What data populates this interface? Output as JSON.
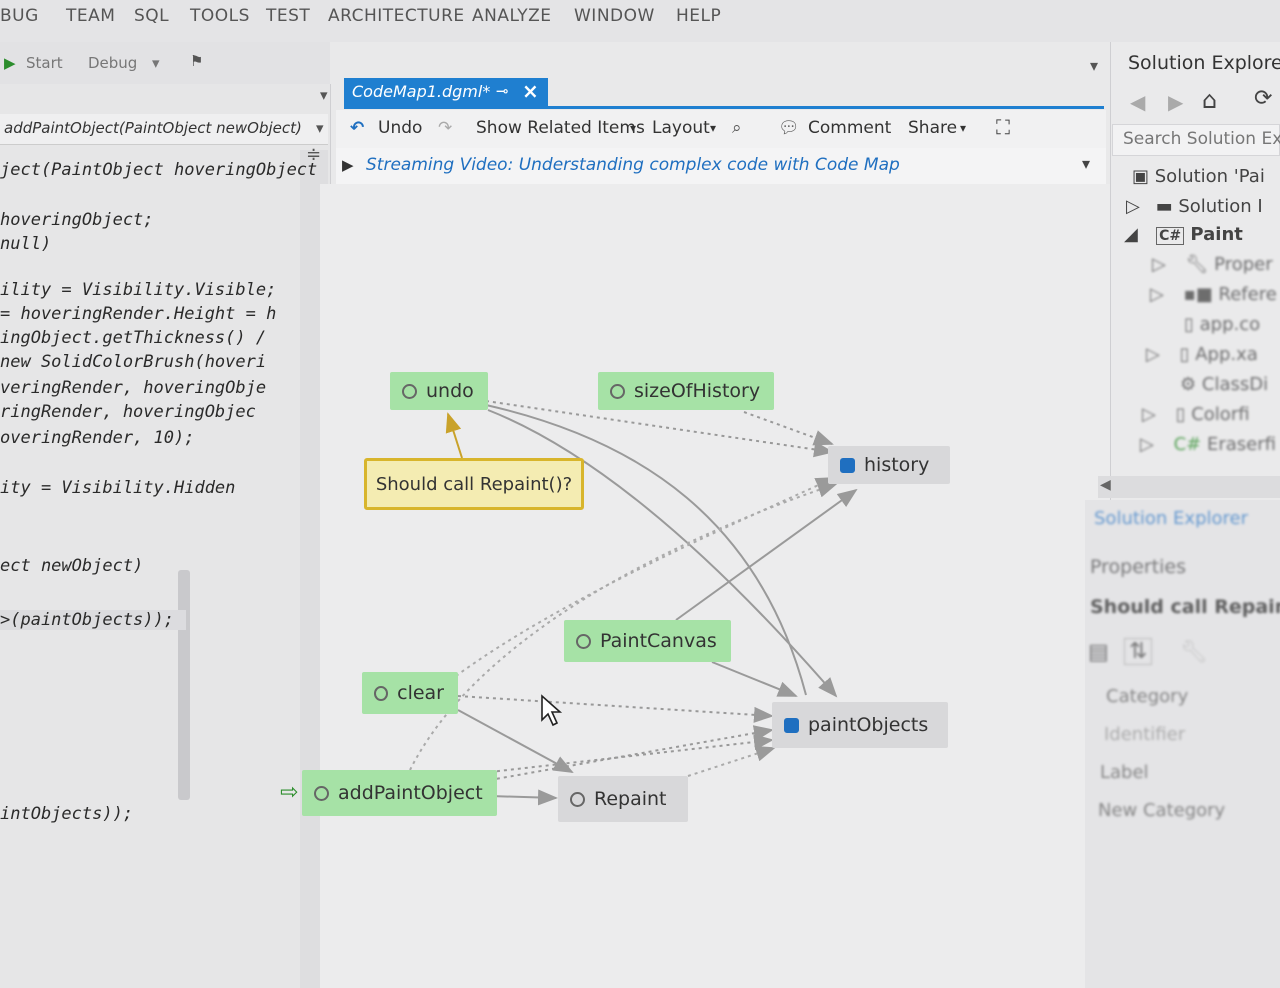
{
  "menu": [
    "BUG",
    "TEAM",
    "SQL",
    "TOOLS",
    "TEST",
    "ARCHITECTURE",
    "ANALYZE",
    "WINDOW",
    "HELP"
  ],
  "toolbar": {
    "start": "Start",
    "config": "Debug"
  },
  "editor": {
    "member_dropdown": "addPaintObject(PaintObject newObject)",
    "lines": [
      "ject(PaintObject hoveringObject",
      "hoveringObject;",
      "null)",
      "ility = Visibility.Visible;",
      "= hoveringRender.Height = h",
      "ingObject.getThickness() /",
      "new SolidColorBrush(hoveri",
      "veringRender, hoveringObje",
      "ringRender, hoveringObjec",
      "overingRender, 10);",
      "ity = Visibility.Hidden",
      "ect newObject)",
      ">(paintObjects));",
      "intObjects));"
    ]
  },
  "document": {
    "tab_title": "CodeMap1.dgml*",
    "toolbar": {
      "undo": "Undo",
      "show_related": "Show Related Items",
      "layout": "Layout",
      "comment": "Comment",
      "share": "Share"
    },
    "info_bar": "Streaming Video: Understanding complex code with Code Map"
  },
  "codemap": {
    "nodes": {
      "undo": "undo",
      "sizeOfHistory": "sizeOfHistory",
      "history": "history",
      "PaintCanvas": "PaintCanvas",
      "clear": "clear",
      "paintObjects": "paintObjects",
      "addPaintObject": "addPaintObject",
      "Repaint": "Repaint"
    },
    "comment": "Should call Repaint()?"
  },
  "solution_explorer": {
    "title": "Solution Explorer",
    "search_placeholder": "Search Solution Ex",
    "items": [
      "Solution 'Pai",
      "Solution I",
      "Paint",
      "Proper",
      "Refere",
      "app.co",
      "App.xa",
      "ClassDi",
      "Colorfi",
      "Eraserfi"
    ],
    "tab_label": "Solution Explorer"
  },
  "properties": {
    "title": "Properties",
    "selected": "Should call Repaint",
    "rows": [
      "Category",
      "Identifier",
      "Label",
      "New Category"
    ]
  },
  "colors": {
    "accent": "#1f7fd0",
    "node_method": "#a6e2a6",
    "node_other": "#d8d8da",
    "comment_bg": "#f4ecb2",
    "comment_border": "#d8b52c"
  }
}
